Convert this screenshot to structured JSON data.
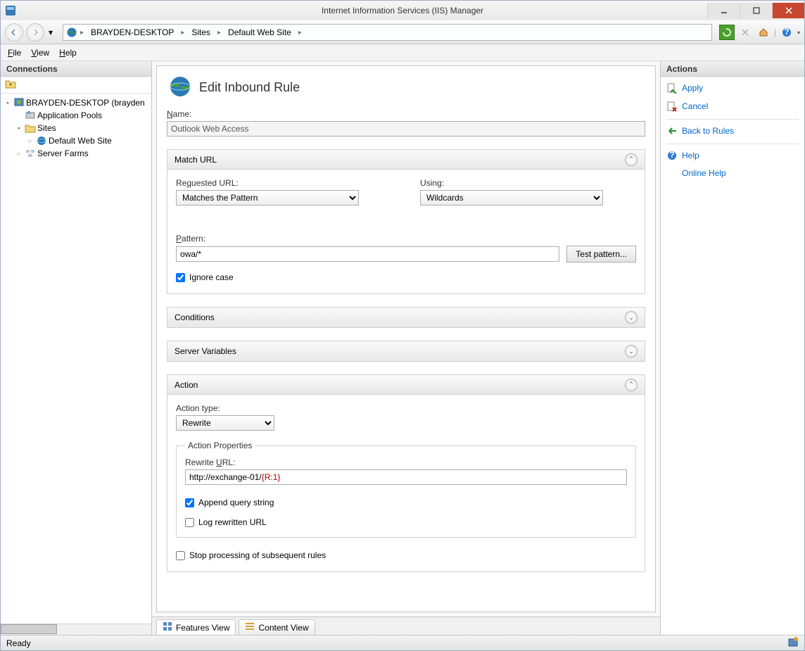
{
  "window": {
    "title": "Internet Information Services (IIS) Manager"
  },
  "breadcrumb": {
    "host": "BRAYDEN-DESKTOP",
    "sites": "Sites",
    "site": "Default Web Site"
  },
  "menu": {
    "file": "File",
    "view": "View",
    "help": "Help"
  },
  "connections": {
    "header": "Connections",
    "host": "BRAYDEN-DESKTOP (brayden",
    "app_pools": "Application Pools",
    "sites": "Sites",
    "default_site": "Default Web Site",
    "server_farms": "Server Farms"
  },
  "page": {
    "title": "Edit Inbound Rule",
    "name_label": "Name:",
    "name_value": "Outlook Web Access"
  },
  "match": {
    "header": "Match URL",
    "req_label": "Requested URL:",
    "req_value": "Matches the Pattern",
    "using_label": "Using:",
    "using_value": "Wildcards",
    "pattern_label": "Pattern:",
    "pattern_value": "owa/*",
    "test_btn": "Test pattern...",
    "ignore_case": "Ignore case"
  },
  "conditions": {
    "header": "Conditions"
  },
  "server_vars": {
    "header": "Server Variables"
  },
  "action": {
    "header": "Action",
    "type_label": "Action type:",
    "type_value": "Rewrite",
    "props_legend": "Action Properties",
    "rewrite_label": "Rewrite URL:",
    "rewrite_prefix": "http://exchange-01/",
    "rewrite_brace": "{R:1}",
    "append": "Append query string",
    "log": "Log rewritten URL",
    "stop": "Stop processing of subsequent rules"
  },
  "tabs": {
    "features": "Features View",
    "content": "Content View"
  },
  "actions": {
    "header": "Actions",
    "apply": "Apply",
    "cancel": "Cancel",
    "back": "Back to Rules",
    "help": "Help",
    "online": "Online Help"
  },
  "status": {
    "ready": "Ready"
  }
}
